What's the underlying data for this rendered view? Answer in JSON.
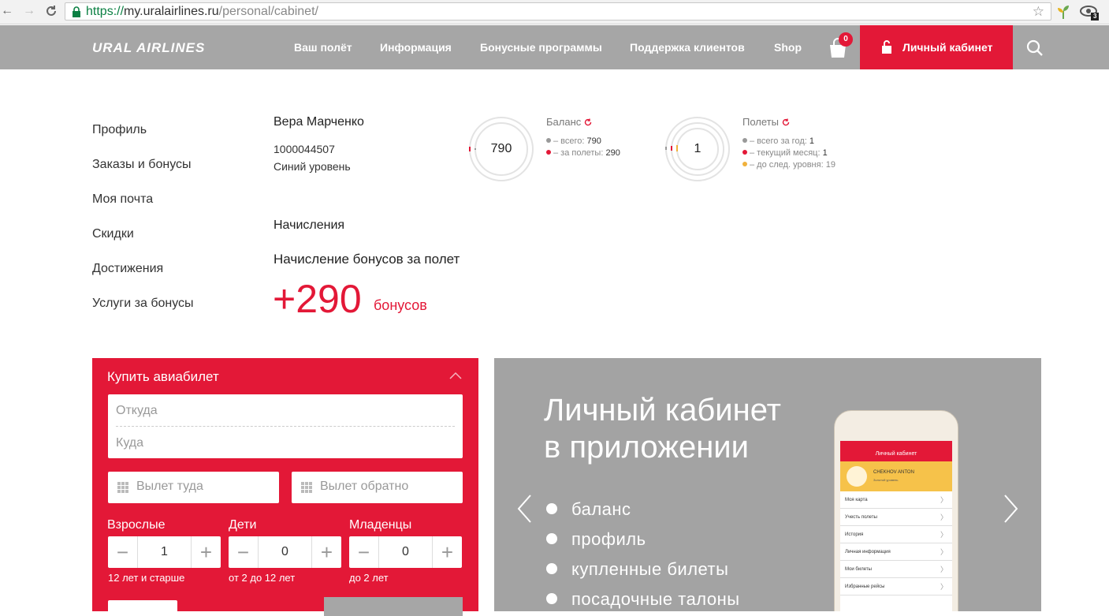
{
  "browser": {
    "url_protocol": "https://",
    "url_host": "my.uralairlines.ru",
    "url_path": "/personal/cabinet/",
    "ext_badge": "3"
  },
  "header": {
    "logo": "URAL AIRLINES",
    "menu": [
      "Ваш полёт",
      "Информация",
      "Бонусные программы",
      "Поддержка клиентов",
      "Shop"
    ],
    "cart_count": "0",
    "cabinet_label": "Личный кабинет"
  },
  "sidebar": {
    "items": [
      "Профиль",
      "Заказы и бонусы",
      "Моя почта",
      "Скидки",
      "Достижения",
      "Услуги за бонусы"
    ]
  },
  "profile": {
    "name": "Вера Марченко",
    "number": "1000044507",
    "level": "Синий уровень"
  },
  "balance": {
    "title": "Баланс",
    "value": "790",
    "total_label": "– всего:",
    "total_value": "790",
    "flights_label": "– за полеты:",
    "flights_value": "290"
  },
  "flights": {
    "title": "Полеты",
    "value": "1",
    "year_label": "– всего за год:",
    "year_value": "1",
    "month_label": "– текущий месяц:",
    "month_value": "1",
    "next_label": "– до след. уровня:",
    "next_value": "19"
  },
  "accruals": {
    "title": "Начисления",
    "subtitle": "Начисление бонусов за полет",
    "amount": "+290",
    "unit": "бонусов"
  },
  "buy": {
    "title": "Купить авиабилет",
    "from_placeholder": "Откуда",
    "to_placeholder": "Куда",
    "depart_placeholder": "Вылет туда",
    "return_placeholder": "Вылет обратно",
    "adults_label": "Взрослые",
    "adults_value": "1",
    "adults_note": "12 лет и старше",
    "children_label": "Дети",
    "children_value": "0",
    "children_note": "от 2 до 12 лет",
    "infants_label": "Младенцы",
    "infants_value": "0",
    "infants_note": "до 2 лет"
  },
  "promo": {
    "title_line1": "Личный кабинет",
    "title_line2": "в приложении",
    "items": [
      "баланс",
      "профиль",
      "купленные билеты",
      "посадочные талоны"
    ],
    "phone": {
      "app_title": "Личный кабинет",
      "user_name": "CHEKHOV ANTON",
      "user_level": "Золотой уровень",
      "rows": [
        "Моя карта",
        "Учесть полеты",
        "История",
        "Личная информация",
        "Мои билеты",
        "Избранные рейсы"
      ]
    }
  },
  "colors": {
    "brand_red": "#e31837",
    "header_gray": "#a6a6a6",
    "promo_gray": "#a3a3a3",
    "accent_yellow": "#f0b13c"
  }
}
